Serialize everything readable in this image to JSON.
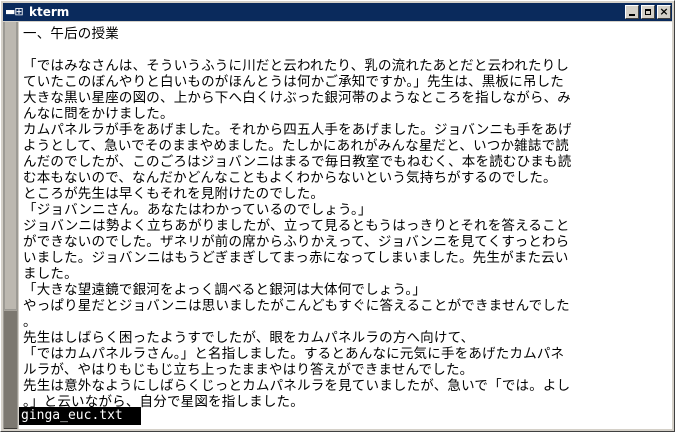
{
  "window": {
    "title": "kterm",
    "system_menu_icon": "system-menu-icon",
    "controls": [
      {
        "name": "minimize-icon"
      },
      {
        "name": "maximize-icon"
      },
      {
        "name": "close-icon",
        "glyph": "×"
      }
    ],
    "titlebar_color": "#0a2a5c"
  },
  "terminal": {
    "lines": [
      "一、午后の授業",
      "",
      "「ではみなさんは、そういうふうに川だと云われたり、乳の流れたあとだと云われたりし",
      "ていたこのぼんやりと白いものがほんとうは何かご承知ですか。」先生は、黒板に吊した",
      "大きな黒い星座の図の、上から下へ白くけぶった銀河帯のようなところを指しながら、み",
      "んなに問をかけました。",
      "カムパネルラが手をあげました。それから四五人手をあげました。ジョバンニも手をあげ",
      "ようとして、急いでそのままやめました。たしかにあれがみんな星だと、いつか雑誌で読",
      "んだのでしたが、このごろはジョバンニはまるで毎日教室でもねむく、本を読むひまも読",
      "む本もないので、なんだかどんなこともよくわからないという気持ちがするのでした。",
      "ところが先生は早くもそれを見附けたのでした。",
      "「ジョバンニさん。あなたはわかっているのでしょう。」",
      "ジョバンニは勢よく立ちあがりましたが、立って見るともうはっきりとそれを答えること",
      "ができないのでした。ザネリが前の席からふりかえって、ジョバンニを見てくすっとわら",
      "いました。ジョバンニはもうどぎまぎしてまっ赤になってしまいました。先生がまた云い",
      "ました。",
      "「大きな望遠鏡で銀河をよっく調べると銀河は大体何でしょう。」",
      "やっぱり星だとジョバンニは思いましたがこんどもすぐに答えることができませんでした",
      "。",
      "先生はしばらく困ったようすでしたが、眼をカムパネルラの方へ向けて、",
      "「ではカムパネルラさん。」と名指しました。するとあんなに元気に手をあげたカムパネ",
      "ルラが、やはりもじもじ立ち上ったままやはり答えができませんでした。",
      "先生は意外なようにしばらくじっとカムパネルラを見ていましたが、急いで「では。よし",
      "。」と云いながら、自分で星図を指しました。"
    ],
    "status": "ginga_euc.txt"
  }
}
